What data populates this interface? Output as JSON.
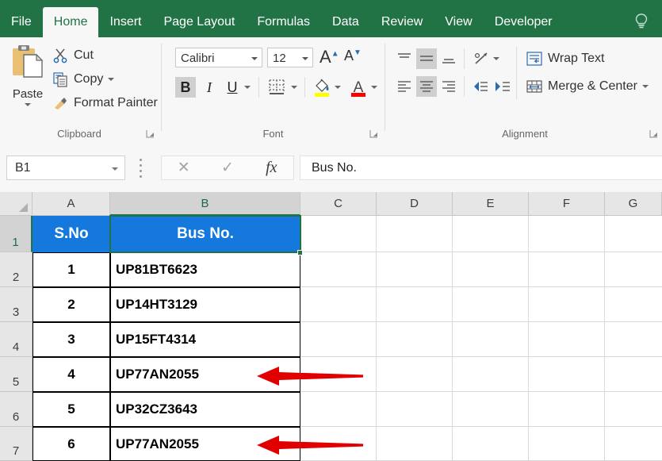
{
  "window": {
    "app": "Microsoft Excel"
  },
  "tabs": [
    {
      "label": "File",
      "active": false
    },
    {
      "label": "Home",
      "active": true
    },
    {
      "label": "Insert",
      "active": false
    },
    {
      "label": "Page Layout",
      "active": false
    },
    {
      "label": "Formulas",
      "active": false
    },
    {
      "label": "Data",
      "active": false
    },
    {
      "label": "Review",
      "active": false
    },
    {
      "label": "View",
      "active": false
    },
    {
      "label": "Developer",
      "active": false
    }
  ],
  "tell_me": {
    "icon": "lightbulb-icon"
  },
  "ribbon": {
    "clipboard": {
      "group_label": "Clipboard",
      "paste_label": "Paste",
      "cut_label": "Cut",
      "copy_label": "Copy",
      "format_painter_label": "Format Painter"
    },
    "font": {
      "group_label": "Font",
      "font_name": "Calibri",
      "font_size": "12",
      "bold_label": "B",
      "italic_label": "I",
      "underline_label": "U",
      "bold_active": true,
      "grow_font_label": "A",
      "shrink_font_label": "A",
      "fill_color": "#ffff00",
      "font_color": "#ff0000"
    },
    "alignment": {
      "group_label": "Alignment",
      "wrap_text_label": "Wrap Text",
      "merge_center_label": "Merge & Center",
      "middle_align_active": true,
      "center_align_active": true
    }
  },
  "formula_bar": {
    "name_box_value": "B1",
    "cancel_icon": "close-icon",
    "enter_icon": "check-icon",
    "function_icon": "fx",
    "formula_value": "Bus No."
  },
  "sheet": {
    "column_headers": [
      "A",
      "B",
      "C",
      "D",
      "E",
      "F",
      "G"
    ],
    "selected_column": "B",
    "row_headers": [
      "1",
      "2",
      "3",
      "4",
      "5",
      "6",
      "7"
    ],
    "selected_row": "1",
    "selected_cell": "B1",
    "header_fill": "#1478dc",
    "selection_border": "#217346",
    "table": {
      "headers": [
        "S.No",
        "Bus No."
      ],
      "rows": [
        {
          "sno": "1",
          "bus_no": "UP81BT6623"
        },
        {
          "sno": "2",
          "bus_no": "UP14HT3129"
        },
        {
          "sno": "3",
          "bus_no": "UP15FT4314"
        },
        {
          "sno": "4",
          "bus_no": "UP77AN2055"
        },
        {
          "sno": "5",
          "bus_no": "UP32CZ3643"
        },
        {
          "sno": "6",
          "bus_no": "UP77AN2055"
        }
      ]
    }
  },
  "annotations": {
    "color": "#e00000",
    "arrows": [
      {
        "name": "duplicate-arrow-row5",
        "points_to_row": "5"
      },
      {
        "name": "duplicate-arrow-row7",
        "points_to_row": "7"
      }
    ]
  }
}
